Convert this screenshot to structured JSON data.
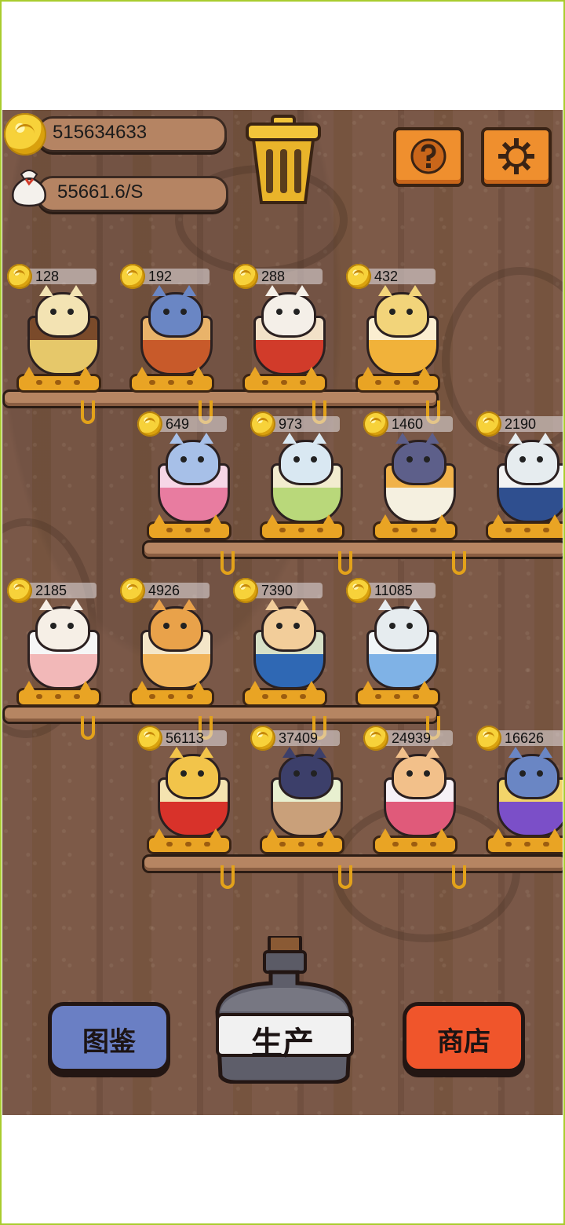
{
  "hud": {
    "coins": "515634633",
    "income_rate": "55661.6/S"
  },
  "colors": {
    "wood": "#765443",
    "shelf": "#b68562",
    "stand": "#e9a424",
    "help_button": "#ef8f2e",
    "catalog_button": "#6a7fc4",
    "shop_button": "#f0552b",
    "frame_border": "#a9cc2e"
  },
  "icons": {
    "trash": "trash-can-icon",
    "help": "question-mark-icon",
    "settings": "gear-icon",
    "coin": "gold-coin-icon",
    "bag": "money-bag-icon"
  },
  "shelves": [
    {
      "prices": [
        "128",
        "192",
        "288",
        "432"
      ]
    },
    {
      "prices": [
        "649",
        "973",
        "1460",
        "2190"
      ]
    },
    {
      "prices": [
        "2185",
        "4926",
        "7390",
        "11085"
      ]
    },
    {
      "prices": [
        "56113",
        "37409",
        "24939",
        "16626"
      ]
    }
  ],
  "buttons": {
    "catalog": "图鉴",
    "produce": "生产",
    "shop": "商店"
  }
}
